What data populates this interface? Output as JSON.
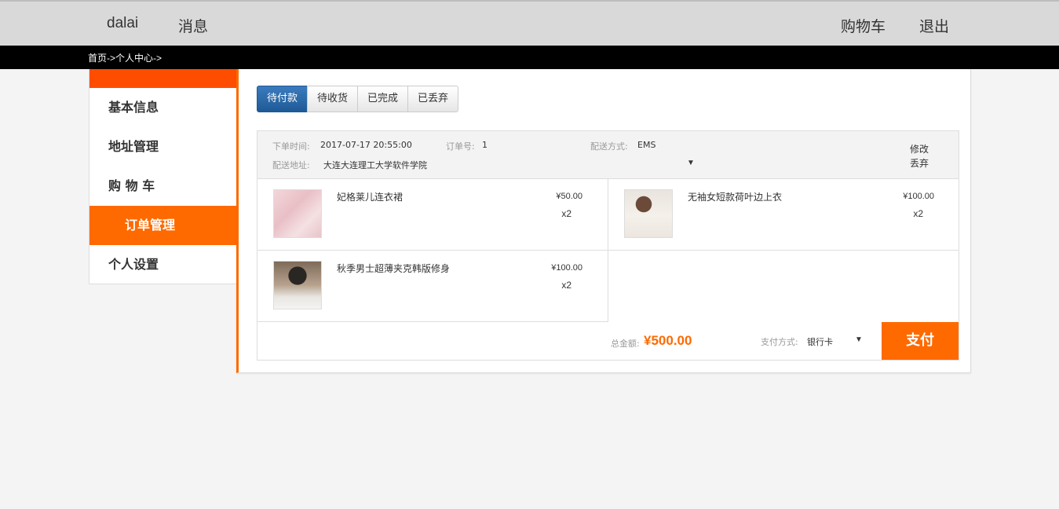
{
  "topnav": {
    "username": "dalai",
    "messages": "消息",
    "cart": "购物车",
    "logout": "退出"
  },
  "breadcrumb": "首页->个人中心->",
  "sidebar": {
    "items": [
      {
        "label": "基本信息"
      },
      {
        "label": "地址管理"
      },
      {
        "label": "购 物 车"
      },
      {
        "label": "订单管理",
        "active": true
      },
      {
        "label": "个人设置"
      }
    ]
  },
  "tabs": [
    {
      "label": "待付款",
      "active": true
    },
    {
      "label": "待收货"
    },
    {
      "label": "已完成"
    },
    {
      "label": "已丢弃"
    }
  ],
  "order": {
    "time_label": "下单时间:",
    "time_value": "2017-07-17 20:55:00",
    "no_label": "订单号:",
    "no_value": "1",
    "ship_label": "配送方式:",
    "ship_value": "EMS",
    "addr_label": "配送地址:",
    "addr_value": "大连大连理工大学软件学院",
    "modify": "修改",
    "discard": "丢弃",
    "items": [
      {
        "name": "妃格莱儿连衣裙",
        "price": "¥50.00",
        "qty": "x2"
      },
      {
        "name": "无袖女短款荷叶边上衣",
        "price": "¥100.00",
        "qty": "x2"
      },
      {
        "name": "秋季男士超薄夹克韩版修身",
        "price": "¥100.00",
        "qty": "x2"
      }
    ],
    "total_label": "总金额:",
    "total_value": "¥500.00",
    "pay_method_label": "支付方式:",
    "pay_method_value": "银行卡",
    "pay_button": "支付"
  },
  "colors": {
    "accent": "#ff6a00",
    "active_tab": "#1e5a96"
  }
}
